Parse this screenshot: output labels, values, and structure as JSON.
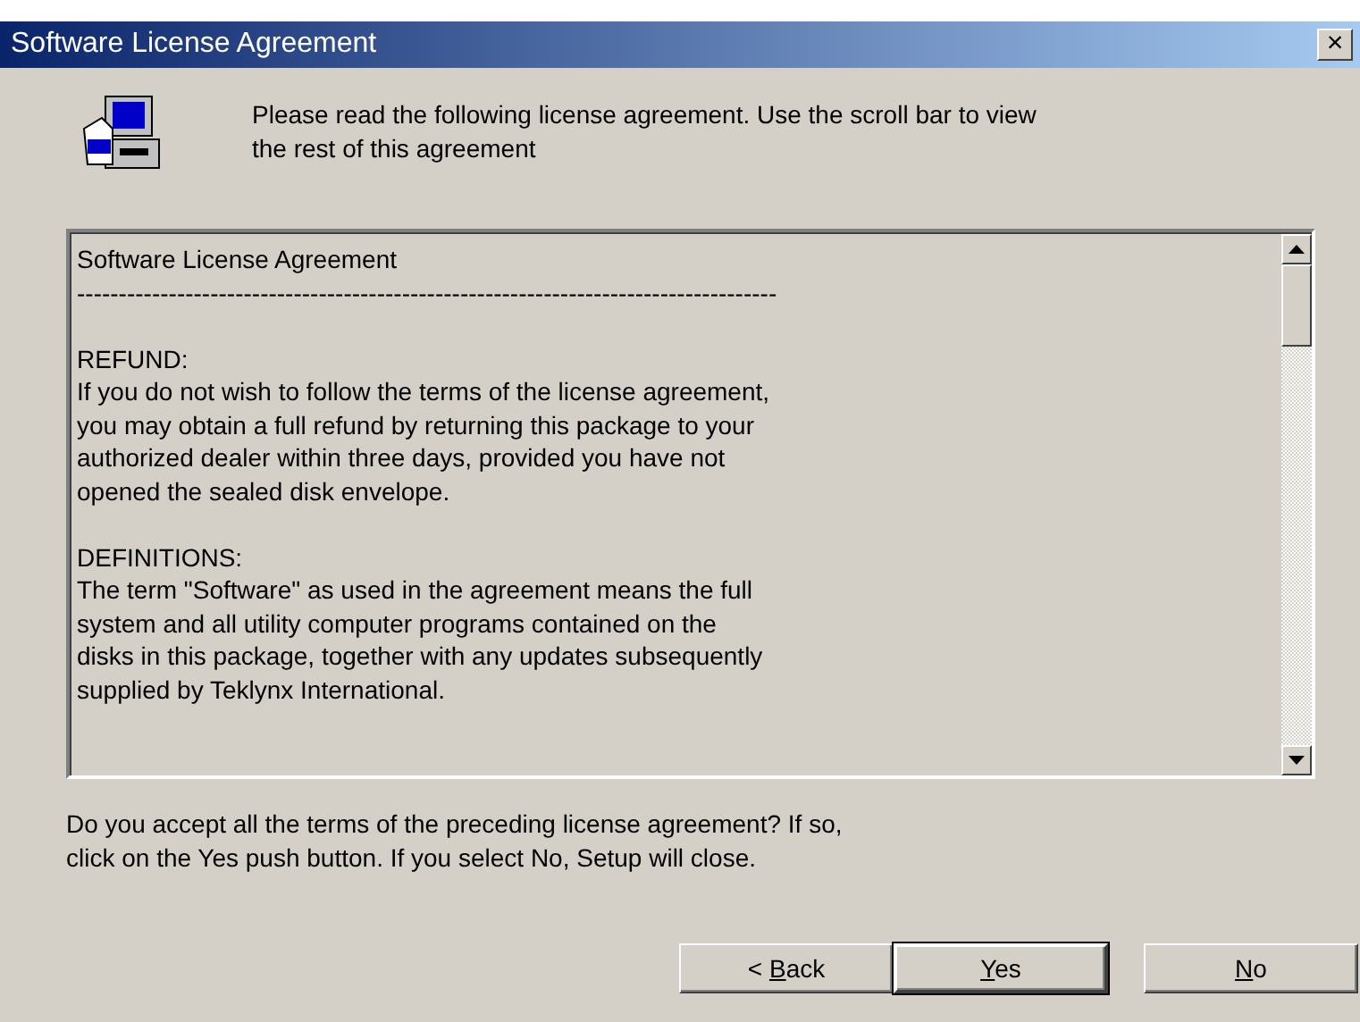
{
  "window": {
    "title": "Software License Agreement",
    "close": "×"
  },
  "header": {
    "lines": [
      "Please read the following license agreement. Use the scroll bar to view",
      "the rest of this agreement"
    ]
  },
  "license_text": {
    "paragraphs": [
      {
        "lines": [
          "Software License Agreement",
          "------------------------------------------------------------------------------------"
        ]
      },
      {
        "lines": [
          "REFUND:",
          "If you do not wish to follow the terms of the license agreement,",
          "you may obtain a full refund by returning this package to your",
          "authorized dealer within three days, provided you have not",
          "opened the sealed disk envelope."
        ]
      },
      {
        "lines": [
          "DEFINITIONS:",
          "The term \"Software\" as used in the agreement means the full",
          "system and all utility  computer programs contained on the",
          "disks in this package, together with any updates  subsequently",
          "supplied by Teklynx International."
        ]
      }
    ]
  },
  "prompt": {
    "lines": [
      "Do you accept all the terms of the preceding license agreement?  If so,",
      "click on the Yes push button. If you select No, Setup will close."
    ]
  },
  "buttons": [
    {
      "before": "< ",
      "access_key": "B",
      "after": "ack",
      "default": false
    },
    {
      "access_key": "Y",
      "after": "es",
      "default": true
    },
    {
      "access_key": "N",
      "after": "o",
      "default": false
    }
  ]
}
